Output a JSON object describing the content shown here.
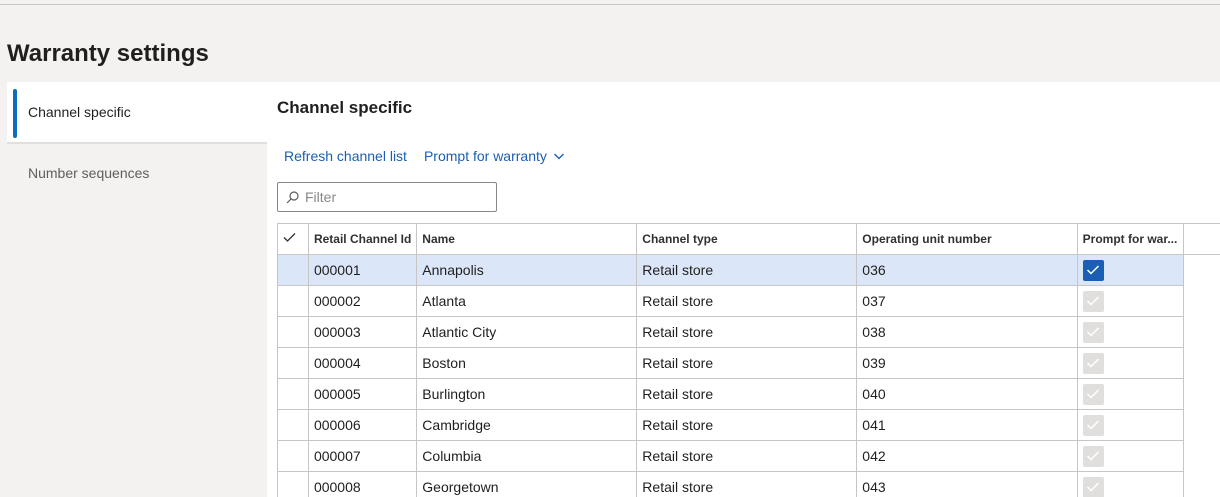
{
  "page": {
    "title": "Warranty settings"
  },
  "nav": {
    "items": [
      {
        "label": "Channel specific",
        "active": true
      },
      {
        "label": "Number sequences",
        "active": false
      }
    ]
  },
  "section": {
    "title": "Channel specific"
  },
  "toolbar": {
    "refresh_label": "Refresh channel list",
    "prompt_label": "Prompt for warranty"
  },
  "filter": {
    "placeholder": "Filter"
  },
  "table": {
    "columns": [
      "Retail Channel Id",
      "Name",
      "Channel type",
      "Operating unit number",
      "Prompt for war..."
    ],
    "rows": [
      {
        "id": "000001",
        "name": "Annapolis",
        "type": "Retail store",
        "unit": "036",
        "prompt": true,
        "selected": true
      },
      {
        "id": "000002",
        "name": "Atlanta",
        "type": "Retail store",
        "unit": "037",
        "prompt": true,
        "selected": false
      },
      {
        "id": "000003",
        "name": "Atlantic City",
        "type": "Retail store",
        "unit": "038",
        "prompt": true,
        "selected": false
      },
      {
        "id": "000004",
        "name": "Boston",
        "type": "Retail store",
        "unit": "039",
        "prompt": true,
        "selected": false
      },
      {
        "id": "000005",
        "name": "Burlington",
        "type": "Retail store",
        "unit": "040",
        "prompt": true,
        "selected": false
      },
      {
        "id": "000006",
        "name": "Cambridge",
        "type": "Retail store",
        "unit": "041",
        "prompt": true,
        "selected": false
      },
      {
        "id": "000007",
        "name": "Columbia",
        "type": "Retail store",
        "unit": "042",
        "prompt": true,
        "selected": false
      },
      {
        "id": "000008",
        "name": "Georgetown",
        "type": "Retail store",
        "unit": "043",
        "prompt": true,
        "selected": false
      }
    ]
  },
  "colors": {
    "accent": "#1a5fb4",
    "selected_row": "#dbe6f8"
  }
}
